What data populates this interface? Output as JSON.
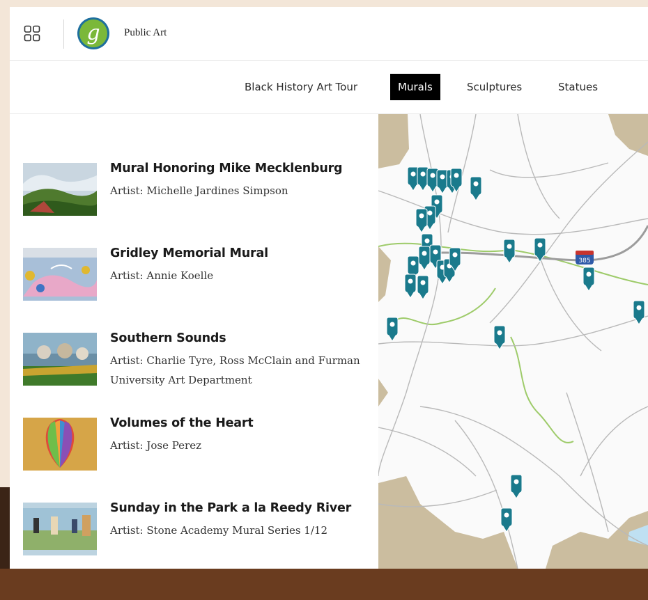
{
  "header": {
    "title": "Public Art"
  },
  "nav": {
    "tabs": [
      {
        "label": "Black History Art Tour",
        "active": false
      },
      {
        "label": "Murals",
        "active": true
      },
      {
        "label": "Sculptures",
        "active": false
      },
      {
        "label": "Statues",
        "active": false
      }
    ]
  },
  "artworks": [
    {
      "title": "Mural Honoring Mike Mecklenburg",
      "artist": "Artist: Michelle Jardines Simpson"
    },
    {
      "title": "Gridley Memorial Mural",
      "artist": "Artist: Annie Koelle"
    },
    {
      "title": "Southern Sounds",
      "artist": "Artist: Charlie Tyre, Ross McClain and Furman University Art Department"
    },
    {
      "title": "Volumes of the Heart",
      "artist": "Artist: Jose Perez"
    },
    {
      "title": "Sunday in the Park a la Reedy River",
      "artist": "Artist: Stone Academy Mural Series 1/12"
    }
  ],
  "map": {
    "highway_shield": "385"
  },
  "colors": {
    "pin": "#1a7a8c",
    "active_tab": "#000000",
    "footer": "#6a3c1f",
    "page_bg": "#f3e6d8"
  },
  "icons": {
    "apps": "grid-icon",
    "logo": "city-logo-g"
  }
}
